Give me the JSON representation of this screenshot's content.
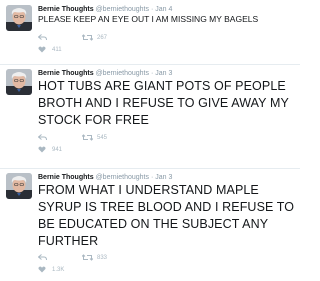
{
  "tweets": [
    {
      "name": "Bernie Thoughts",
      "handle": "@berniethoughts",
      "separator": "·",
      "date": "Jan 4",
      "text": "PLEASE KEEP AN EYE OUT I AM MISSING MY BAGELS",
      "retweets": "267",
      "likes": "411"
    },
    {
      "name": "Bernie Thoughts",
      "handle": "@berniethoughts",
      "separator": "·",
      "date": "Jan 3",
      "text": "HOT TUBS ARE GIANT POTS OF PEOPLE BROTH AND I REFUSE TO GIVE AWAY MY STOCK FOR FREE",
      "retweets": "545",
      "likes": "941"
    },
    {
      "name": "Bernie Thoughts",
      "handle": "@berniethoughts",
      "separator": "·",
      "date": "Jan 3",
      "text": "FROM WHAT I UNDERSTAND MAPLE SYRUP IS TREE BLOOD AND I REFUSE TO BE EDUCATED ON THE SUBJECT ANY FURTHER",
      "retweets": "833",
      "likes": "1.3K"
    }
  ],
  "colors": {
    "text": "#14171a",
    "muted": "#8899a6",
    "icon": "#aab8c2",
    "divider": "#e6ecf0"
  },
  "icons": [
    "reply-icon",
    "retweet-icon",
    "heart-icon",
    "avatar-portrait"
  ]
}
